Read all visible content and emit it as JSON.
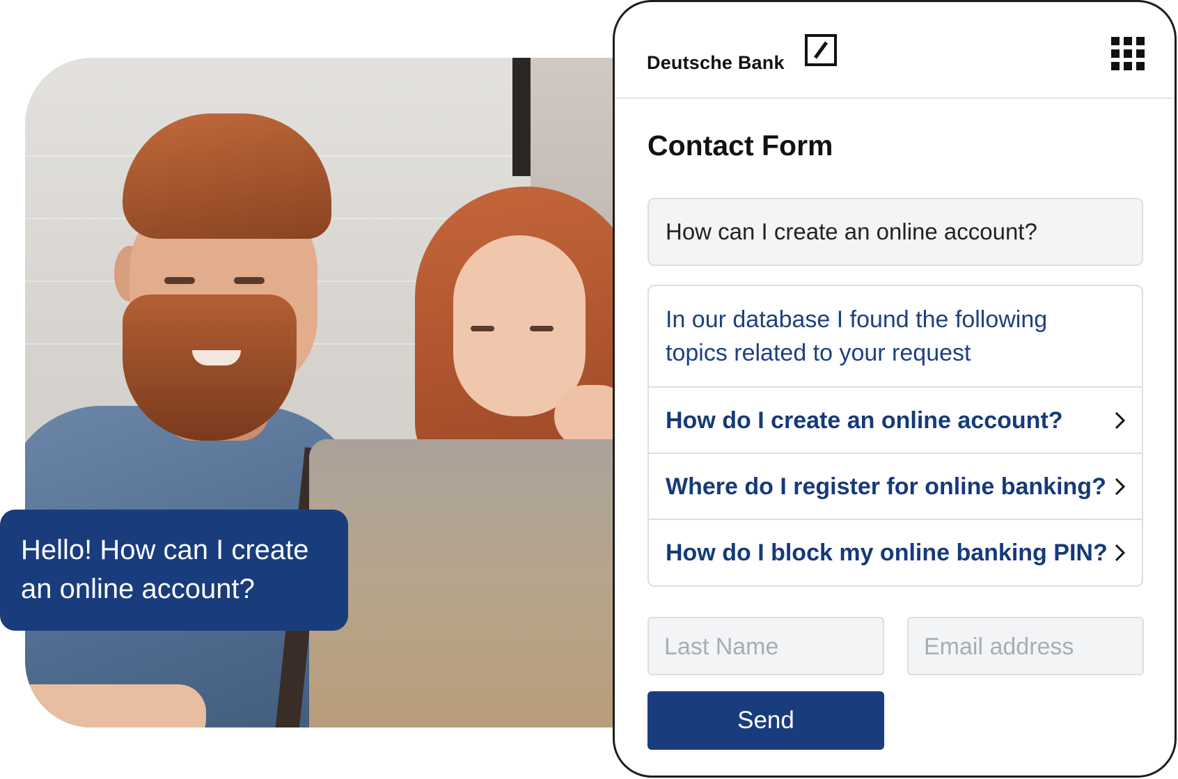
{
  "bubble": {
    "line1": "Hello! How can I create",
    "line2": "an online account?"
  },
  "panel": {
    "brand": "Deutsche Bank",
    "title": "Contact Form",
    "question": "How can I create an online account?",
    "results_intro_line1": "In our database I found the following",
    "results_intro_line2": "topics related to your request",
    "results": [
      {
        "label": "How do I create an online account?"
      },
      {
        "label": "Where do I register for online banking?"
      },
      {
        "label": "How do I block my online banking PIN?"
      }
    ],
    "last_name_placeholder": "Last Name",
    "email_placeholder": "Email address",
    "send_label": "Send"
  },
  "colors": {
    "brand_blue": "#193c7d",
    "link_blue": "#163a7a",
    "border": "#dcdee2",
    "field_bg": "#f3f4f6"
  },
  "icons": [
    "deutsche-bank-logo-icon",
    "apps-grid-icon",
    "chevron-right-icon"
  ]
}
